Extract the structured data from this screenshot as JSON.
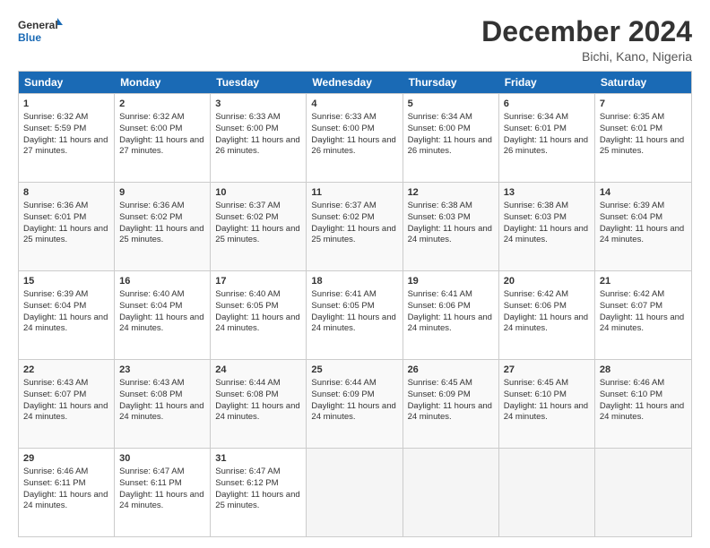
{
  "header": {
    "logo_line1": "General",
    "logo_line2": "Blue",
    "month_title": "December 2024",
    "location": "Bichi, Kano, Nigeria"
  },
  "days": [
    "Sunday",
    "Monday",
    "Tuesday",
    "Wednesday",
    "Thursday",
    "Friday",
    "Saturday"
  ],
  "weeks": [
    [
      {
        "day": "1",
        "sunrise": "6:32 AM",
        "sunset": "5:59 PM",
        "daylight": "11 hours and 27 minutes."
      },
      {
        "day": "2",
        "sunrise": "6:32 AM",
        "sunset": "6:00 PM",
        "daylight": "11 hours and 27 minutes."
      },
      {
        "day": "3",
        "sunrise": "6:33 AM",
        "sunset": "6:00 PM",
        "daylight": "11 hours and 26 minutes."
      },
      {
        "day": "4",
        "sunrise": "6:33 AM",
        "sunset": "6:00 PM",
        "daylight": "11 hours and 26 minutes."
      },
      {
        "day": "5",
        "sunrise": "6:34 AM",
        "sunset": "6:00 PM",
        "daylight": "11 hours and 26 minutes."
      },
      {
        "day": "6",
        "sunrise": "6:34 AM",
        "sunset": "6:01 PM",
        "daylight": "11 hours and 26 minutes."
      },
      {
        "day": "7",
        "sunrise": "6:35 AM",
        "sunset": "6:01 PM",
        "daylight": "11 hours and 25 minutes."
      }
    ],
    [
      {
        "day": "8",
        "sunrise": "6:36 AM",
        "sunset": "6:01 PM",
        "daylight": "11 hours and 25 minutes."
      },
      {
        "day": "9",
        "sunrise": "6:36 AM",
        "sunset": "6:02 PM",
        "daylight": "11 hours and 25 minutes."
      },
      {
        "day": "10",
        "sunrise": "6:37 AM",
        "sunset": "6:02 PM",
        "daylight": "11 hours and 25 minutes."
      },
      {
        "day": "11",
        "sunrise": "6:37 AM",
        "sunset": "6:02 PM",
        "daylight": "11 hours and 25 minutes."
      },
      {
        "day": "12",
        "sunrise": "6:38 AM",
        "sunset": "6:03 PM",
        "daylight": "11 hours and 24 minutes."
      },
      {
        "day": "13",
        "sunrise": "6:38 AM",
        "sunset": "6:03 PM",
        "daylight": "11 hours and 24 minutes."
      },
      {
        "day": "14",
        "sunrise": "6:39 AM",
        "sunset": "6:04 PM",
        "daylight": "11 hours and 24 minutes."
      }
    ],
    [
      {
        "day": "15",
        "sunrise": "6:39 AM",
        "sunset": "6:04 PM",
        "daylight": "11 hours and 24 minutes."
      },
      {
        "day": "16",
        "sunrise": "6:40 AM",
        "sunset": "6:04 PM",
        "daylight": "11 hours and 24 minutes."
      },
      {
        "day": "17",
        "sunrise": "6:40 AM",
        "sunset": "6:05 PM",
        "daylight": "11 hours and 24 minutes."
      },
      {
        "day": "18",
        "sunrise": "6:41 AM",
        "sunset": "6:05 PM",
        "daylight": "11 hours and 24 minutes."
      },
      {
        "day": "19",
        "sunrise": "6:41 AM",
        "sunset": "6:06 PM",
        "daylight": "11 hours and 24 minutes."
      },
      {
        "day": "20",
        "sunrise": "6:42 AM",
        "sunset": "6:06 PM",
        "daylight": "11 hours and 24 minutes."
      },
      {
        "day": "21",
        "sunrise": "6:42 AM",
        "sunset": "6:07 PM",
        "daylight": "11 hours and 24 minutes."
      }
    ],
    [
      {
        "day": "22",
        "sunrise": "6:43 AM",
        "sunset": "6:07 PM",
        "daylight": "11 hours and 24 minutes."
      },
      {
        "day": "23",
        "sunrise": "6:43 AM",
        "sunset": "6:08 PM",
        "daylight": "11 hours and 24 minutes."
      },
      {
        "day": "24",
        "sunrise": "6:44 AM",
        "sunset": "6:08 PM",
        "daylight": "11 hours and 24 minutes."
      },
      {
        "day": "25",
        "sunrise": "6:44 AM",
        "sunset": "6:09 PM",
        "daylight": "11 hours and 24 minutes."
      },
      {
        "day": "26",
        "sunrise": "6:45 AM",
        "sunset": "6:09 PM",
        "daylight": "11 hours and 24 minutes."
      },
      {
        "day": "27",
        "sunrise": "6:45 AM",
        "sunset": "6:10 PM",
        "daylight": "11 hours and 24 minutes."
      },
      {
        "day": "28",
        "sunrise": "6:46 AM",
        "sunset": "6:10 PM",
        "daylight": "11 hours and 24 minutes."
      }
    ],
    [
      {
        "day": "29",
        "sunrise": "6:46 AM",
        "sunset": "6:11 PM",
        "daylight": "11 hours and 24 minutes."
      },
      {
        "day": "30",
        "sunrise": "6:47 AM",
        "sunset": "6:11 PM",
        "daylight": "11 hours and 24 minutes."
      },
      {
        "day": "31",
        "sunrise": "6:47 AM",
        "sunset": "6:12 PM",
        "daylight": "11 hours and 25 minutes."
      },
      null,
      null,
      null,
      null
    ]
  ]
}
